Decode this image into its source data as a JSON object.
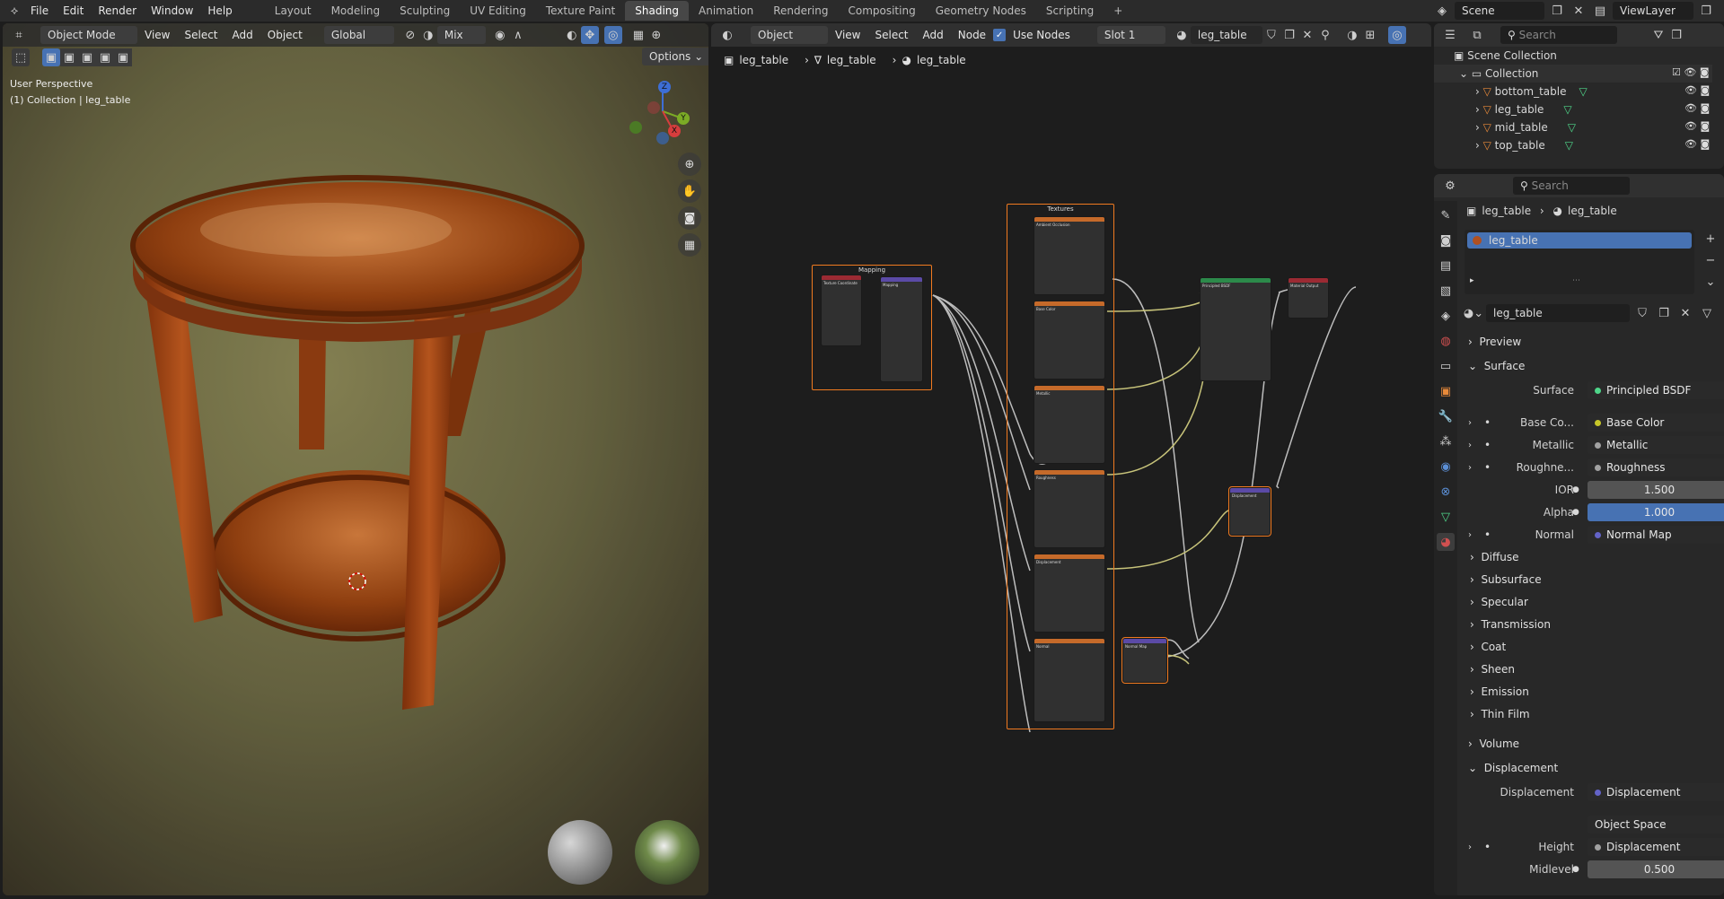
{
  "menu": {
    "items": [
      "File",
      "Edit",
      "Render",
      "Window",
      "Help"
    ]
  },
  "workspaces": {
    "tabs": [
      "Layout",
      "Modeling",
      "Sculpting",
      "UV Editing",
      "Texture Paint",
      "Shading",
      "Animation",
      "Rendering",
      "Compositing",
      "Geometry Nodes",
      "Scripting"
    ],
    "active": "Shading",
    "add": "+"
  },
  "scene": {
    "name": "Scene",
    "view_layer": "ViewLayer"
  },
  "viewport": {
    "mode": "Object Mode",
    "menus": [
      "View",
      "Select",
      "Add",
      "Object"
    ],
    "orientation": "Global",
    "pivot": "Mix",
    "options": "Options",
    "perspective": "User Perspective",
    "context": "(1) Collection | leg_table",
    "gizmo": {
      "x": "X",
      "y": "Y",
      "z": "Z"
    }
  },
  "node_editor": {
    "object": "Object",
    "menus": [
      "View",
      "Select",
      "Add",
      "Node"
    ],
    "use_nodes": "Use Nodes",
    "slot": "Slot 1",
    "material": "leg_table",
    "breadcrumb": [
      "leg_table",
      "leg_table",
      "leg_table"
    ],
    "frames": {
      "mapping": "Mapping",
      "textures": "Textures"
    },
    "nodes": {
      "tex_coord": "Texture Coordinate",
      "mapping": "Mapping",
      "ambient": "Ambient Occlusion",
      "base_color": "Base Color",
      "metallic": "Metallic",
      "roughness": "Roughness",
      "displacement_tex": "Displacement",
      "normal_tex": "Normal",
      "bsdf": "Principled BSDF",
      "output": "Material Output",
      "displacement": "Displacement",
      "normal_map": "Normal Map"
    }
  },
  "outliner": {
    "search": "Search",
    "root": "Scene Collection",
    "collection": "Collection",
    "objects": [
      "bottom_table",
      "leg_table",
      "mid_table",
      "top_table"
    ]
  },
  "properties": {
    "search": "Search",
    "breadcrumb": [
      "leg_table",
      "leg_table"
    ],
    "slot_item": "leg_table",
    "material_name": "leg_table",
    "sections": {
      "preview": "Preview",
      "surface": "Surface",
      "volume": "Volume",
      "displacement": "Displacement"
    },
    "surface": {
      "label": "Surface",
      "value": "Principled BSDF"
    },
    "inputs": [
      {
        "label": "Base Co...",
        "value": "Base Color",
        "color": "#c7c729"
      },
      {
        "label": "Metallic",
        "value": "Metallic",
        "color": "#a1a1a1"
      },
      {
        "label": "Roughne...",
        "value": "Roughness",
        "color": "#a1a1a1"
      }
    ],
    "ior": {
      "label": "IOR",
      "value": "1.500"
    },
    "alpha": {
      "label": "Alpha",
      "value": "1.000"
    },
    "normal": {
      "label": "Normal",
      "value": "Normal Map"
    },
    "subpanels": [
      "Diffuse",
      "Subsurface",
      "Specular",
      "Transmission",
      "Coat",
      "Sheen",
      "Emission",
      "Thin Film"
    ],
    "disp": {
      "label": "Displacement",
      "value": "Displacement",
      "space": "Object Space",
      "height_label": "Height",
      "height_value": "Displacement",
      "midlevel_label": "Midlevel",
      "midlevel_value": "0.500"
    }
  }
}
